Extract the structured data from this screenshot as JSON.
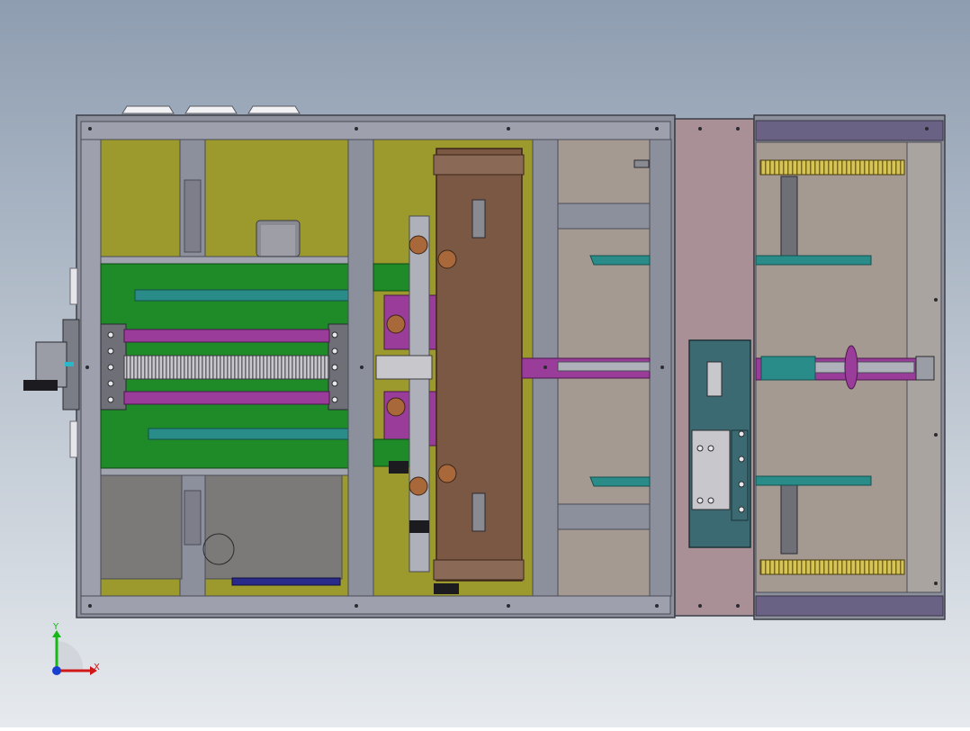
{
  "viewport": {
    "background_top": "#8e9db0",
    "background_bottom": "#e6eaee"
  },
  "triad": {
    "x_label": "X",
    "y_label": "Y",
    "x_color": "#d01818",
    "y_color": "#18b818",
    "z_color": "#1840d0"
  },
  "colors": {
    "frame": "#8c8f9c",
    "frame_dark": "#4a4c56",
    "olive": "#9c9a2c",
    "green": "#1e8a28",
    "teal": "#2a8c88",
    "purple": "#9a3c9a",
    "brown": "#7a5844",
    "gray_panel": "#7c7a78",
    "beige": "#a49a92",
    "mauve": "#a89096",
    "slate": "#3c6a72",
    "yellow": "#d8c858"
  }
}
